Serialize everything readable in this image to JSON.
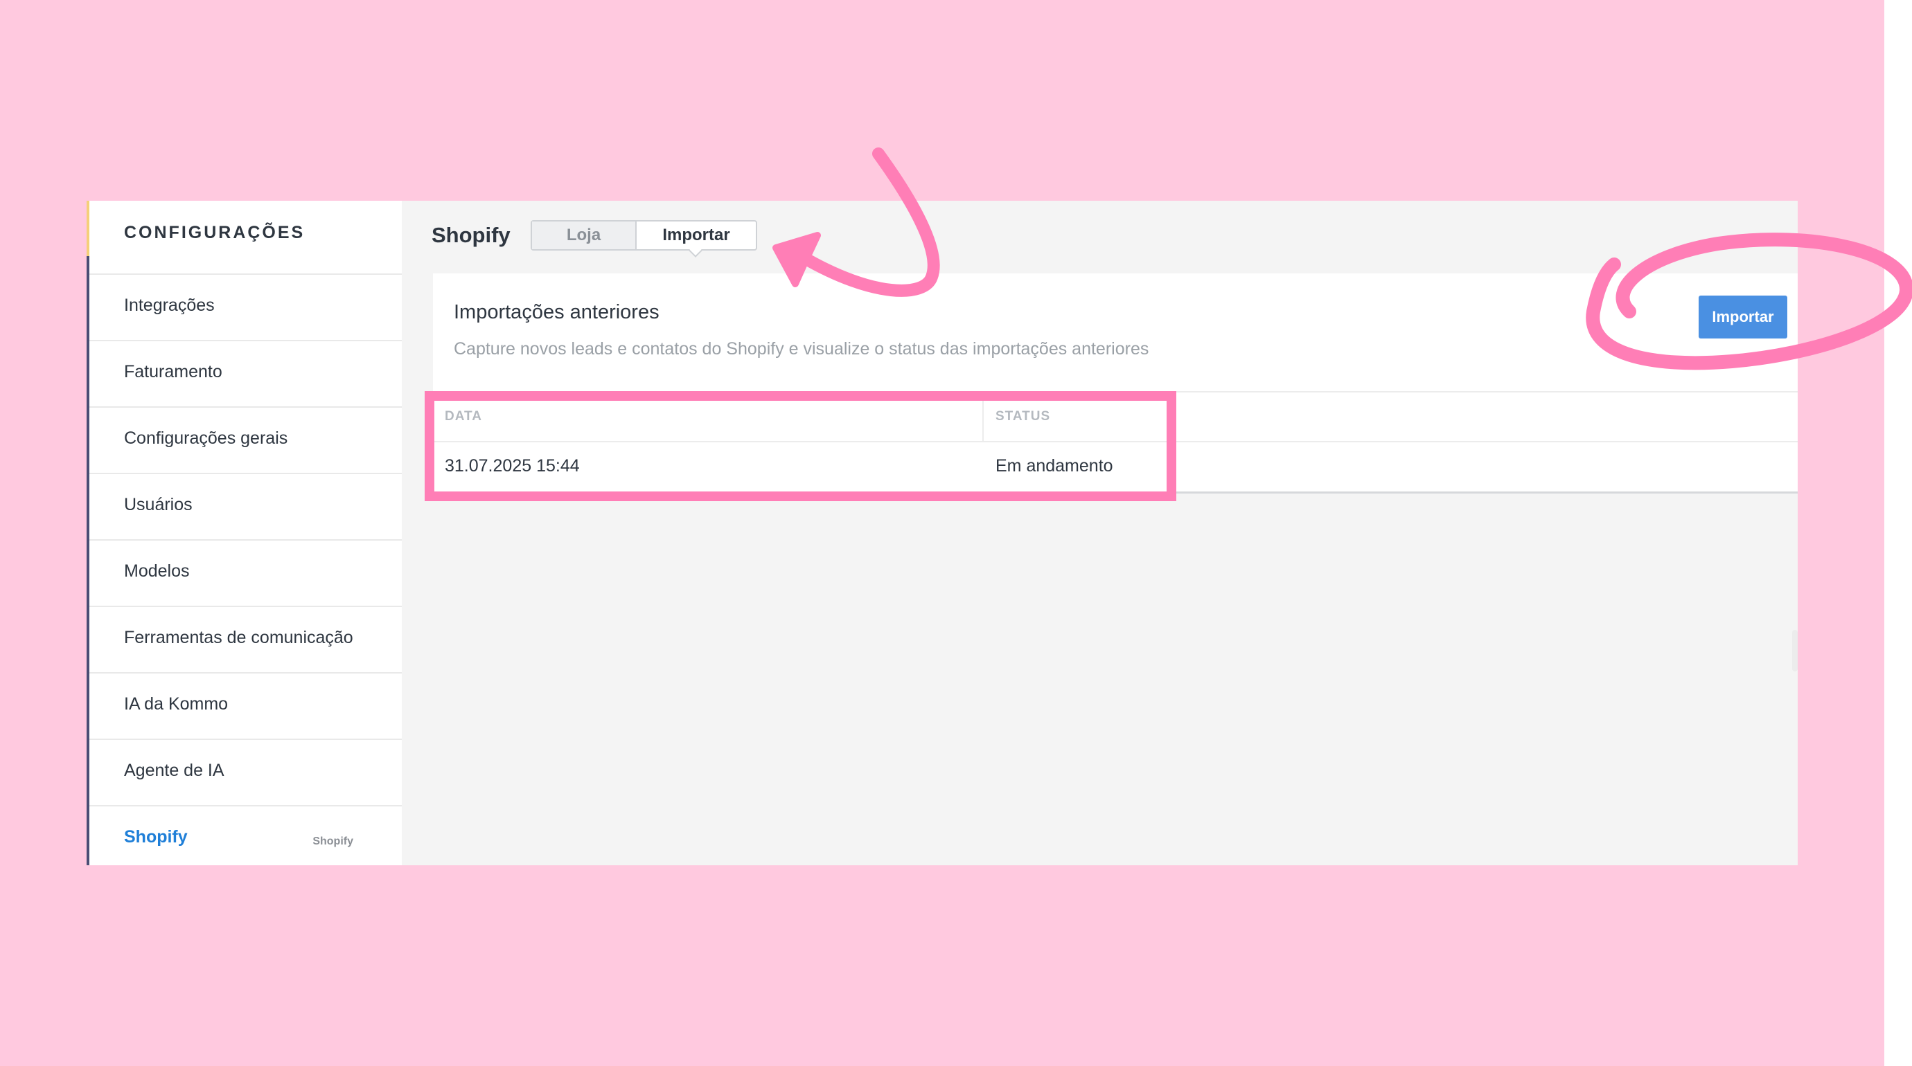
{
  "sidebar": {
    "title": "CONFIGURAÇÕES",
    "items": [
      {
        "label": "Integrações"
      },
      {
        "label": "Faturamento"
      },
      {
        "label": "Configurações gerais"
      },
      {
        "label": "Usuários"
      },
      {
        "label": "Modelos"
      },
      {
        "label": "Ferramentas de comunicação"
      },
      {
        "label": "IA da Kommo"
      },
      {
        "label": "Agente de IA"
      },
      {
        "label": "Shopify",
        "badge": "Shopify",
        "active": true
      }
    ]
  },
  "header": {
    "title": "Shopify",
    "tabs": [
      {
        "label": "Loja",
        "selected": false
      },
      {
        "label": "Importar",
        "selected": true
      }
    ]
  },
  "panel": {
    "title": "Importações anteriores",
    "description": "Capture novos leads e contatos do Shopify e visualize o status das importações anteriores",
    "import_button": "Importar",
    "table": {
      "columns": [
        "DATA",
        "STATUS"
      ],
      "rows": [
        [
          "31.07.2025 15:44",
          "Em andamento"
        ]
      ]
    }
  },
  "colors": {
    "background": "#ffc9df",
    "annotation": "#ff7eb6",
    "accent_blue": "#4a90e2",
    "active_link": "#1f7fd8"
  },
  "annotations": {
    "icons": [
      "curved-arrow-icon",
      "hand-drawn-circle-icon",
      "highlight-box"
    ]
  }
}
